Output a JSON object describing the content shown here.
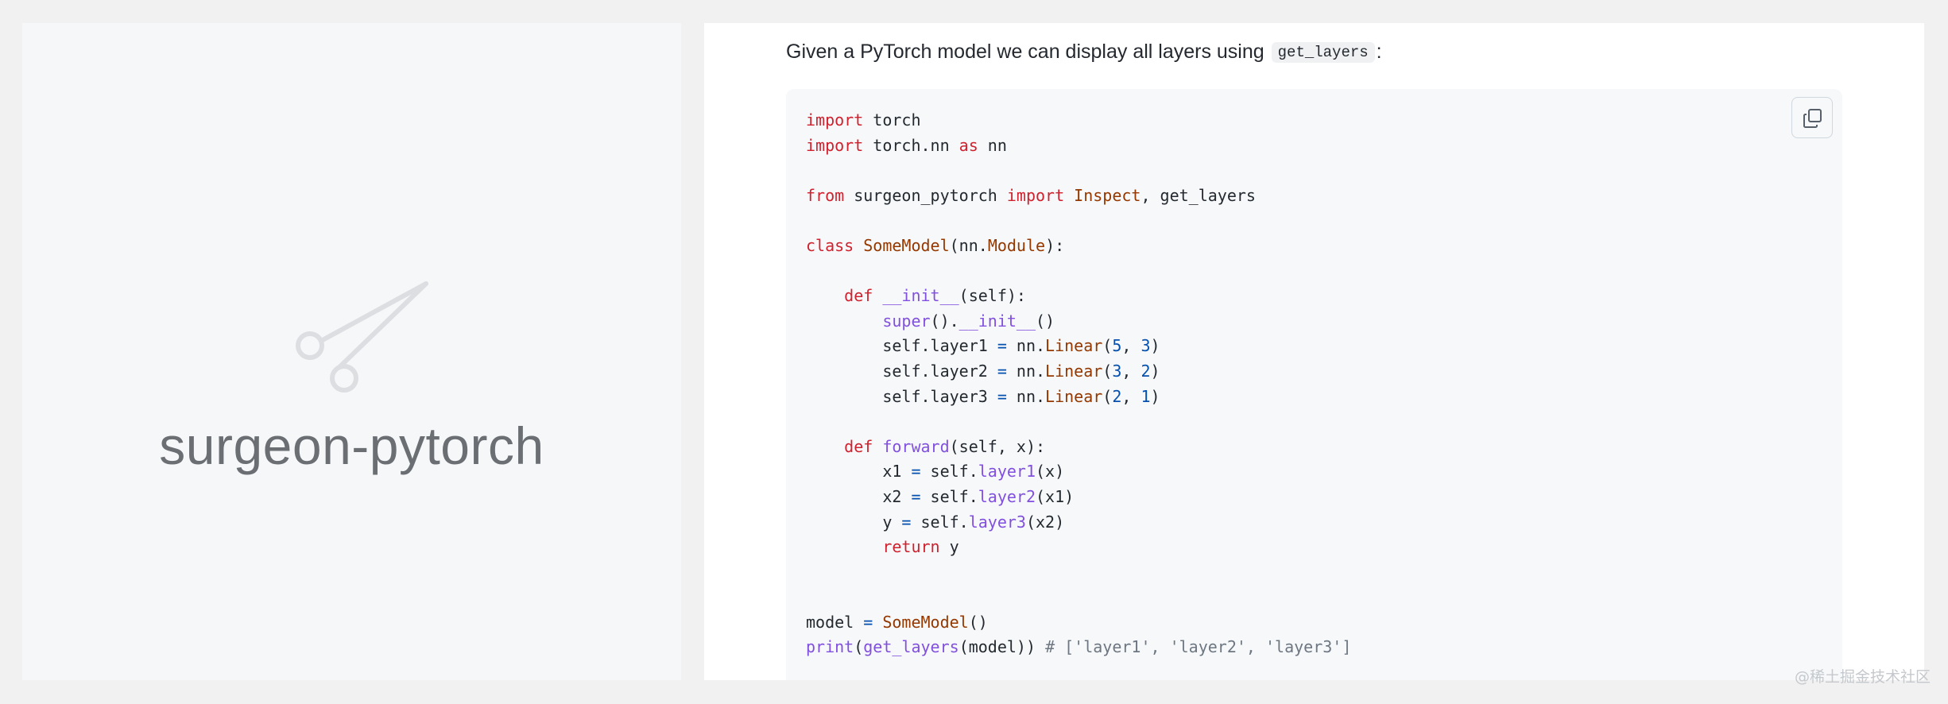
{
  "left_panel": {
    "logo_icon": "scissors-icon",
    "logo_text": "surgeon-pytorch"
  },
  "right_panel": {
    "intro_text": "Given a PyTorch model we can display all layers using",
    "intro_code": "get_layers",
    "intro_suffix": ":",
    "copy_icon": "copy-icon",
    "code_lines": [
      [
        [
          "kw",
          "import"
        ],
        [
          "plain",
          " torch"
        ]
      ],
      [
        [
          "kw",
          "import"
        ],
        [
          "plain",
          " torch.nn "
        ],
        [
          "kw",
          "as"
        ],
        [
          "plain",
          " nn"
        ]
      ],
      [],
      [
        [
          "kw",
          "from"
        ],
        [
          "plain",
          " surgeon_pytorch "
        ],
        [
          "kw",
          "import"
        ],
        [
          "plain",
          " "
        ],
        [
          "cls",
          "Inspect"
        ],
        [
          "plain",
          ", get_layers"
        ]
      ],
      [],
      [
        [
          "kw",
          "class"
        ],
        [
          "plain",
          " "
        ],
        [
          "cls",
          "SomeModel"
        ],
        [
          "plain",
          "(nn."
        ],
        [
          "cls",
          "Module"
        ],
        [
          "plain",
          "):"
        ]
      ],
      [],
      [
        [
          "plain",
          "    "
        ],
        [
          "kw",
          "def"
        ],
        [
          "plain",
          " "
        ],
        [
          "fn",
          "__init__"
        ],
        [
          "plain",
          "(self):"
        ]
      ],
      [
        [
          "plain",
          "        "
        ],
        [
          "fn",
          "super"
        ],
        [
          "plain",
          "()."
        ],
        [
          "fn",
          "__init__"
        ],
        [
          "plain",
          "()"
        ]
      ],
      [
        [
          "plain",
          "        self.layer1 "
        ],
        [
          "op",
          "="
        ],
        [
          "plain",
          " nn."
        ],
        [
          "cls",
          "Linear"
        ],
        [
          "plain",
          "("
        ],
        [
          "num",
          "5"
        ],
        [
          "plain",
          ", "
        ],
        [
          "num",
          "3"
        ],
        [
          "plain",
          ")"
        ]
      ],
      [
        [
          "plain",
          "        self.layer2 "
        ],
        [
          "op",
          "="
        ],
        [
          "plain",
          " nn."
        ],
        [
          "cls",
          "Linear"
        ],
        [
          "plain",
          "("
        ],
        [
          "num",
          "3"
        ],
        [
          "plain",
          ", "
        ],
        [
          "num",
          "2"
        ],
        [
          "plain",
          ")"
        ]
      ],
      [
        [
          "plain",
          "        self.layer3 "
        ],
        [
          "op",
          "="
        ],
        [
          "plain",
          " nn."
        ],
        [
          "cls",
          "Linear"
        ],
        [
          "plain",
          "("
        ],
        [
          "num",
          "2"
        ],
        [
          "plain",
          ", "
        ],
        [
          "num",
          "1"
        ],
        [
          "plain",
          ")"
        ]
      ],
      [],
      [
        [
          "plain",
          "    "
        ],
        [
          "kw",
          "def"
        ],
        [
          "plain",
          " "
        ],
        [
          "fn",
          "forward"
        ],
        [
          "plain",
          "(self, x):"
        ]
      ],
      [
        [
          "plain",
          "        x1 "
        ],
        [
          "op",
          "="
        ],
        [
          "plain",
          " self."
        ],
        [
          "fn",
          "layer1"
        ],
        [
          "plain",
          "(x)"
        ]
      ],
      [
        [
          "plain",
          "        x2 "
        ],
        [
          "op",
          "="
        ],
        [
          "plain",
          " self."
        ],
        [
          "fn",
          "layer2"
        ],
        [
          "plain",
          "(x1)"
        ]
      ],
      [
        [
          "plain",
          "        y "
        ],
        [
          "op",
          "="
        ],
        [
          "plain",
          " self."
        ],
        [
          "fn",
          "layer3"
        ],
        [
          "plain",
          "(x2)"
        ]
      ],
      [
        [
          "plain",
          "        "
        ],
        [
          "kw",
          "return"
        ],
        [
          "plain",
          " y"
        ]
      ],
      [],
      [],
      [
        [
          "plain",
          "model "
        ],
        [
          "op",
          "="
        ],
        [
          "plain",
          " "
        ],
        [
          "cls",
          "SomeModel"
        ],
        [
          "plain",
          "()"
        ]
      ],
      [
        [
          "fn",
          "print"
        ],
        [
          "plain",
          "("
        ],
        [
          "fn",
          "get_layers"
        ],
        [
          "plain",
          "(model)) "
        ],
        [
          "cmt",
          "# ['layer1', 'layer2', 'layer3']"
        ]
      ]
    ]
  },
  "watermark": "@稀土掘金技术社区",
  "colors": {
    "keyword": "#cf222e",
    "function": "#8250df",
    "class": "#953800",
    "number": "#0550ae",
    "comment": "#6e7781",
    "code_background": "#f6f8fa"
  }
}
